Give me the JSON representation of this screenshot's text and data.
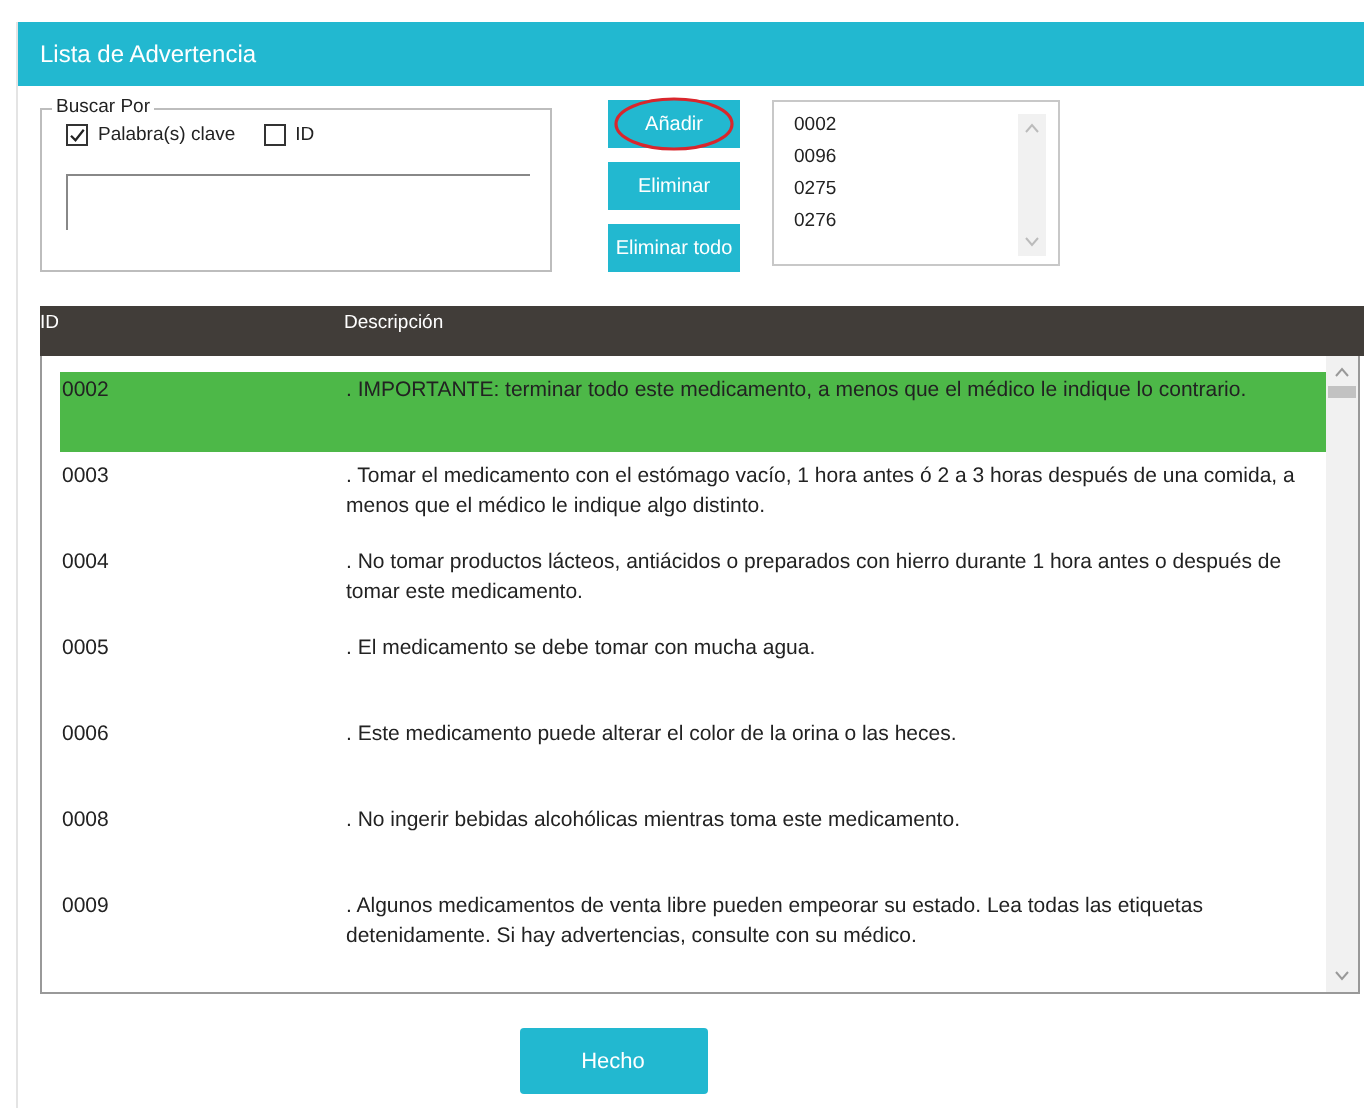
{
  "window": {
    "title": "Lista de Advertencia"
  },
  "search": {
    "group_label": "Buscar Por",
    "options": [
      {
        "label": "Palabra(s) clave",
        "checked": true
      },
      {
        "label": "ID",
        "checked": false
      }
    ]
  },
  "actions": [
    {
      "label": "Añadir",
      "circled": true
    },
    {
      "label": "Eliminar",
      "circled": false
    },
    {
      "label": "Eliminar todo",
      "circled": false
    }
  ],
  "selected_ids": [
    "0002",
    "0096",
    "0275",
    "0276"
  ],
  "table": {
    "columns": [
      "ID",
      "Descripción"
    ],
    "rows": [
      {
        "id": "0002",
        "text": ". IMPORTANTE: terminar todo este medicamento, a menos que el médico le indique lo contrario.",
        "selected": true
      },
      {
        "id": "0003",
        "text": ". Tomar el medicamento con el estómago vacío, 1 hora antes ó 2 a 3 horas después de una comida, a menos que el médico le indique algo distinto.",
        "selected": false
      },
      {
        "id": "0004",
        "text": ". No tomar productos lácteos, antiácidos o preparados con hierro durante 1 hora antes o después de tomar este medicamento.",
        "selected": false
      },
      {
        "id": "0005",
        "text": ". El medicamento se debe tomar con mucha agua.",
        "selected": false
      },
      {
        "id": "0006",
        "text": ". Este medicamento puede alterar el color de la orina o las heces.",
        "selected": false
      },
      {
        "id": "0008",
        "text": ". No ingerir bebidas alcohólicas mientras toma este medicamento.",
        "selected": false
      },
      {
        "id": "0009",
        "text": ". Algunos medicamentos de venta libre pueden empeorar su estado. Lea todas las etiquetas detenidamente. Si hay advertencias, consulte con su médico.",
        "selected": false
      }
    ]
  },
  "done_button": "Hecho"
}
